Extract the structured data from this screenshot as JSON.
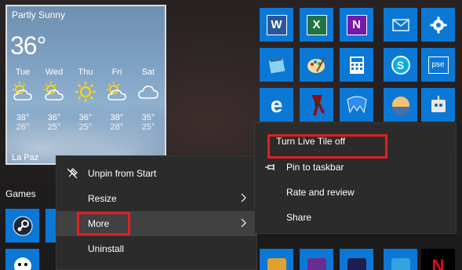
{
  "weather": {
    "condition": "Partly Sunny",
    "temperature": "36°",
    "location": "La Paz",
    "forecast": [
      {
        "day": "Tue",
        "high": "38°",
        "low": "26°",
        "icon": "partly-sunny-icon"
      },
      {
        "day": "Wed",
        "high": "36°",
        "low": "25°",
        "icon": "partly-sunny-icon"
      },
      {
        "day": "Thu",
        "high": "36°",
        "low": "25°",
        "icon": "sunny-icon"
      },
      {
        "day": "Fri",
        "high": "38°",
        "low": "28°",
        "icon": "partly-sunny-icon"
      },
      {
        "day": "Sat",
        "high": "35°",
        "low": "25°",
        "icon": "cloudy-icon"
      }
    ]
  },
  "tiles": [
    {
      "name": "word-tile",
      "icon": "word-icon",
      "letter": "W",
      "color": "#2b579a"
    },
    {
      "name": "excel-tile",
      "icon": "excel-icon",
      "letter": "X",
      "color": "#217346"
    },
    {
      "name": "onenote-tile",
      "icon": "onenote-icon",
      "letter": "N",
      "color": "#7719aa"
    },
    {
      "name": "mail-tile",
      "icon": "mail-icon"
    },
    {
      "name": "settings-tile",
      "icon": "gear-icon"
    },
    {
      "name": "notepad-tile",
      "icon": "notepad-icon"
    },
    {
      "name": "paint-tile",
      "icon": "paint-icon"
    },
    {
      "name": "calculator-tile",
      "icon": "calculator-icon"
    },
    {
      "name": "skype-tile",
      "icon": "skype-icon",
      "letter": "S"
    },
    {
      "name": "pse-tile",
      "icon": "pse-icon",
      "letter": "pse"
    },
    {
      "name": "edge-tile",
      "icon": "edge-icon",
      "letter": "e"
    },
    {
      "name": "app-tile",
      "icon": "tools-icon"
    },
    {
      "name": "malwarebytes-tile",
      "icon": "malwarebytes-icon"
    },
    {
      "name": "app-tile-sunset",
      "icon": "sunset-icon"
    },
    {
      "name": "app-tile-robot",
      "icon": "robot-icon"
    }
  ],
  "games": {
    "label": "Games"
  },
  "context_menu": {
    "items": [
      {
        "label": "Unpin from Start",
        "icon": "unpin-icon"
      },
      {
        "label": "Resize",
        "has_submenu": true
      },
      {
        "label": "More",
        "has_submenu": true,
        "highlighted": true
      },
      {
        "label": "Uninstall"
      }
    ]
  },
  "submenu": {
    "items": [
      {
        "label": "Turn Live Tile off",
        "highlighted": true
      },
      {
        "label": "Pin to taskbar",
        "icon": "pin-icon"
      },
      {
        "label": "Rate and review"
      },
      {
        "label": "Share"
      }
    ]
  },
  "colors": {
    "accent": "#0c78d6",
    "highlight_border": "#e02025",
    "menu_bg": "#2b2b2b"
  }
}
